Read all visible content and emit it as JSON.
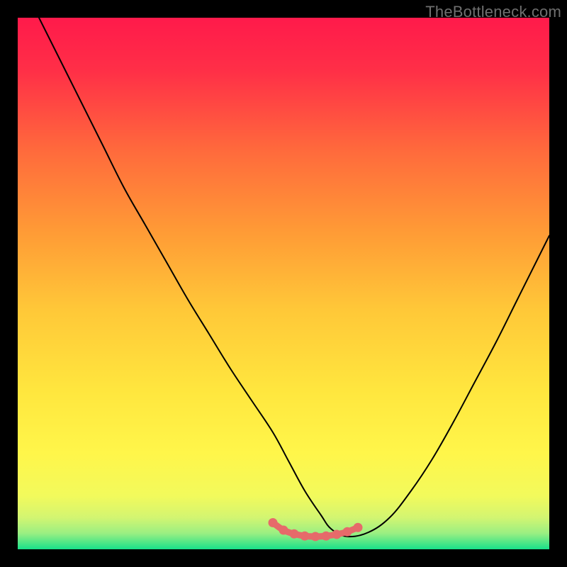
{
  "watermark": "TheBottleneck.com",
  "chart_data": {
    "type": "line",
    "title": "",
    "xlabel": "",
    "ylabel": "",
    "xlim": [
      0,
      100
    ],
    "ylim": [
      0,
      100
    ],
    "grid": false,
    "legend": false,
    "background_gradient": {
      "top_color": "#ff1744",
      "mid_color": "#ffeb3b",
      "bottom_colors": [
        "#eaff6a",
        "#baf87a",
        "#7de889",
        "#00e676"
      ]
    },
    "series": [
      {
        "name": "bottleneck-curve",
        "color": "#000000",
        "x": [
          4,
          8,
          12,
          16,
          20,
          24,
          28,
          32,
          36,
          40,
          44,
          48,
          51,
          54,
          57,
          59,
          62,
          66,
          70,
          74,
          78,
          82,
          86,
          90,
          94,
          98,
          100
        ],
        "y": [
          100,
          92,
          84,
          76,
          68,
          61,
          54,
          47,
          40.5,
          34,
          28,
          22,
          16.5,
          11,
          6.5,
          3.8,
          2.4,
          3.2,
          6,
          11,
          17,
          24,
          31.5,
          39,
          47,
          55,
          59
        ]
      },
      {
        "name": "highlight-segment",
        "color": "#e66a6a",
        "x": [
          48,
          50,
          52,
          54,
          56,
          58,
          60,
          62,
          64
        ],
        "y": [
          5.0,
          3.6,
          2.9,
          2.5,
          2.4,
          2.5,
          2.8,
          3.3,
          4.1
        ]
      }
    ]
  }
}
